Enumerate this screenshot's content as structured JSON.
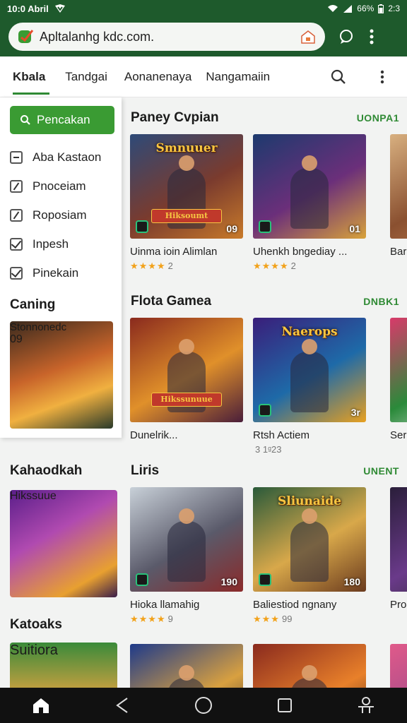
{
  "status": {
    "time": "10:0 Abril",
    "battery": "66%",
    "extra": "2:3"
  },
  "browser": {
    "url": "Apltalanhg kdc.com."
  },
  "tabs": [
    {
      "label": "Kbala",
      "active": true
    },
    {
      "label": "Tandgai"
    },
    {
      "label": "Aonanenaya"
    },
    {
      "label": "Nangamaiin"
    }
  ],
  "sidebar": {
    "search_label": "Pencakan",
    "filters": [
      {
        "label": "Aba Kastaon",
        "state": "minus"
      },
      {
        "label": "Pnoceiam",
        "state": "slash"
      },
      {
        "label": "Roposiam",
        "state": "slash"
      },
      {
        "label": "Inpesh",
        "state": "checked"
      },
      {
        "label": "Pinekain",
        "state": "checked"
      }
    ],
    "heading": "Caning",
    "thumb_badge": "09"
  },
  "left_sections": [
    {
      "title": "Kahaodkah",
      "banner": "Hikssuue"
    },
    {
      "title": "Katoaks",
      "banner": "Suitiora"
    }
  ],
  "sections": [
    {
      "title": "Paney Cvpian",
      "link": "UONPA1",
      "cards": [
        {
          "title": "Uinma ioin Alimlan",
          "stars": "★★★★",
          "rating": "2",
          "art": "Smnuuer",
          "banner": "Hiksoumt",
          "num": "09",
          "colors": [
            "#2e4a78",
            "#7a3b2e",
            "#c87a2a"
          ]
        },
        {
          "title": "Uhenkh bngediay ...",
          "stars": "★★★★",
          "rating": "2",
          "art": "",
          "banner": "",
          "num": "01",
          "colors": [
            "#1d3a6e",
            "#6b2f7a",
            "#d8a23a"
          ]
        },
        {
          "title": "Bar",
          "stars": "",
          "rating": "",
          "art": "",
          "banner": "",
          "num": "",
          "colors": [
            "#d8b080",
            "#8a5030",
            "#c08050"
          ]
        }
      ]
    },
    {
      "title": "Flota Gamea",
      "link": "DNBK1",
      "cards": [
        {
          "title": "Dunelrik...",
          "stars": "",
          "rating": "",
          "art": "",
          "banner": "Hikssunuue",
          "num": "",
          "colors": [
            "#8a2a1e",
            "#e0902a",
            "#4a1e3a"
          ]
        },
        {
          "title": "Rtsh Actiem",
          "stars": "",
          "rating": "3 1ᵍ23",
          "art": "Naerops",
          "banner": "",
          "num": "3r",
          "colors": [
            "#3a1e7a",
            "#1e6aa8",
            "#e8a020"
          ]
        },
        {
          "title": "Ser",
          "stars": "",
          "rating": "",
          "art": "",
          "banner": "",
          "num": "",
          "colors": [
            "#d83a6a",
            "#2a8a3a",
            "#e8e8e8"
          ]
        }
      ]
    },
    {
      "title": "Liris",
      "link": "UNENT",
      "cards": [
        {
          "title": "Hioka llamahig",
          "stars": "★★★★",
          "rating": "9",
          "art": "",
          "banner": "",
          "num": "190",
          "colors": [
            "#c8d0d8",
            "#5a5a6a",
            "#8a2a2a"
          ]
        },
        {
          "title": "Baliestiod ngnany",
          "stars": "★★★",
          "rating": "99",
          "art": "Sliunaide",
          "banner": "",
          "num": "180",
          "colors": [
            "#2a5a3a",
            "#d8a84a",
            "#6a3a1e"
          ]
        },
        {
          "title": "Pro",
          "stars": "",
          "rating": "",
          "art": "",
          "banner": "",
          "num": "",
          "colors": [
            "#2a1e3a",
            "#6a3a8a",
            "#2a2a2a"
          ]
        }
      ]
    },
    {
      "title": "",
      "link": "",
      "cards": [
        {
          "title": "",
          "stars": "",
          "rating": "",
          "art": "",
          "banner": "",
          "num": "",
          "colors": [
            "#1e3a8a",
            "#d8a040",
            "#1e1e2e"
          ]
        },
        {
          "title": "",
          "stars": "",
          "rating": "",
          "art": "",
          "banner": "",
          "num": "",
          "colors": [
            "#8a2a1e",
            "#e8802a",
            "#2a1e1e"
          ]
        },
        {
          "title": "",
          "stars": "",
          "rating": "",
          "art": "",
          "banner": "",
          "num": "",
          "colors": [
            "#e05a8a",
            "#a04a8a",
            "#e8a0c0"
          ]
        }
      ]
    }
  ],
  "colors": {
    "brand": "#1e5a2c",
    "accent": "#3a9b33",
    "link": "#2f8a34",
    "star": "#f2a21b"
  }
}
